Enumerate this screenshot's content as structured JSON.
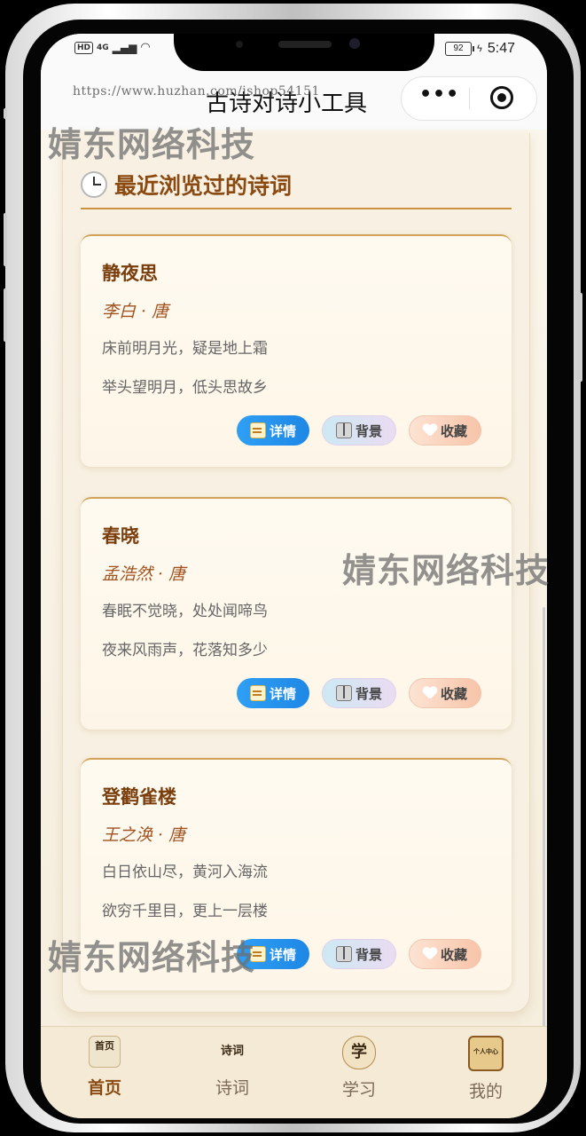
{
  "status_bar": {
    "network_tag": "HD",
    "signal_label": "4G",
    "battery": "92",
    "time": "5:47"
  },
  "url_overlay": "https://www.huzhan.com/ishop54151",
  "nav": {
    "title": "古诗对诗小工具",
    "more_icon": "more-dots-icon",
    "close_icon": "target-circle-icon"
  },
  "section": {
    "title": "最近浏览过的诗词",
    "icon": "clock-icon"
  },
  "poems": [
    {
      "title": "静夜思",
      "author": "李白 · 唐",
      "line1": "床前明月光，疑是地上霜",
      "line2": "举头望明月，低头思故乡"
    },
    {
      "title": "春晓",
      "author": "孟浩然 · 唐",
      "line1": "春眠不觉晓，处处闻啼鸟",
      "line2": "夜来风雨声，花落知多少"
    },
    {
      "title": "登鹳雀楼",
      "author": "王之涣 · 唐",
      "line1": "白日依山尽，黄河入海流",
      "line2": "欲穷千里目，更上一层楼"
    }
  ],
  "buttons": {
    "detail": "详情",
    "background": "背景",
    "favorite": "收藏"
  },
  "watermark": "婧东网络科技",
  "tabs": [
    {
      "label": "首页",
      "icon_text": "首页",
      "active": true
    },
    {
      "label": "诗词",
      "icon_text": "诗词",
      "active": false
    },
    {
      "label": "学习",
      "icon_text": "学",
      "active": false
    },
    {
      "label": "我的",
      "icon_text": "个人中心",
      "active": false
    }
  ],
  "colors": {
    "accent": "#8a4a12",
    "detail_button": "#1e88e5",
    "background": "#f8f1e3"
  }
}
